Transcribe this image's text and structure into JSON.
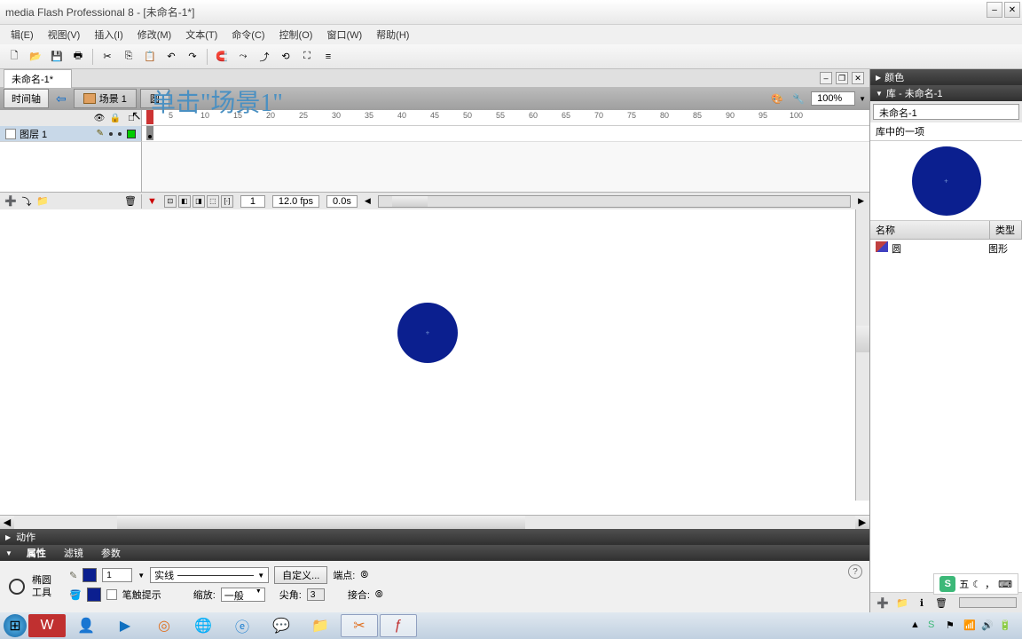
{
  "titlebar": {
    "title": "media Flash Professional 8 - [未命名-1*]"
  },
  "menu": [
    "辑(E)",
    "视图(V)",
    "插入(I)",
    "修改(M)",
    "文本(T)",
    "命令(C)",
    "控制(O)",
    "窗口(W)",
    "帮助(H)"
  ],
  "doc": {
    "tab": "未命名-1*"
  },
  "annotation": "单击\"场景1\"",
  "scenebar": {
    "timeline_btn": "时间轴",
    "back": "⇦",
    "scene": "场景 1",
    "symbol": "圆",
    "zoom": "100%"
  },
  "timeline": {
    "ruler_marks": [
      1,
      5,
      10,
      15,
      20,
      25,
      30,
      35,
      40,
      45,
      50,
      55,
      60,
      65,
      70,
      75,
      80,
      85,
      90,
      95,
      100
    ],
    "layer": "图层 1",
    "current_frame": "1",
    "fps": "12.0 fps",
    "elapsed": "0.0s"
  },
  "actions": {
    "title": "动作"
  },
  "props": {
    "tabs": [
      "属性",
      "滤镜",
      "参数"
    ],
    "tool": "椭圆\n工具",
    "stroke_width": "1",
    "stroke_style": "实线",
    "custom": "自定义...",
    "hint": "笔触提示",
    "scale_label": "缩放:",
    "scale": "一般",
    "cap_label": "端点:",
    "miter_label": "尖角:",
    "miter": "3",
    "join_label": "接合:"
  },
  "panels": {
    "color_title": "颜色",
    "lib_title": "库 - 未命名-1",
    "lib_doc": "未命名-1",
    "lib_count": "库中的一项",
    "name_col": "名称",
    "type_col": "类型",
    "items": [
      {
        "name": "圆",
        "type": "图形"
      }
    ]
  },
  "ime": {
    "label": "五",
    "moon": "☾",
    "comma": "，"
  }
}
